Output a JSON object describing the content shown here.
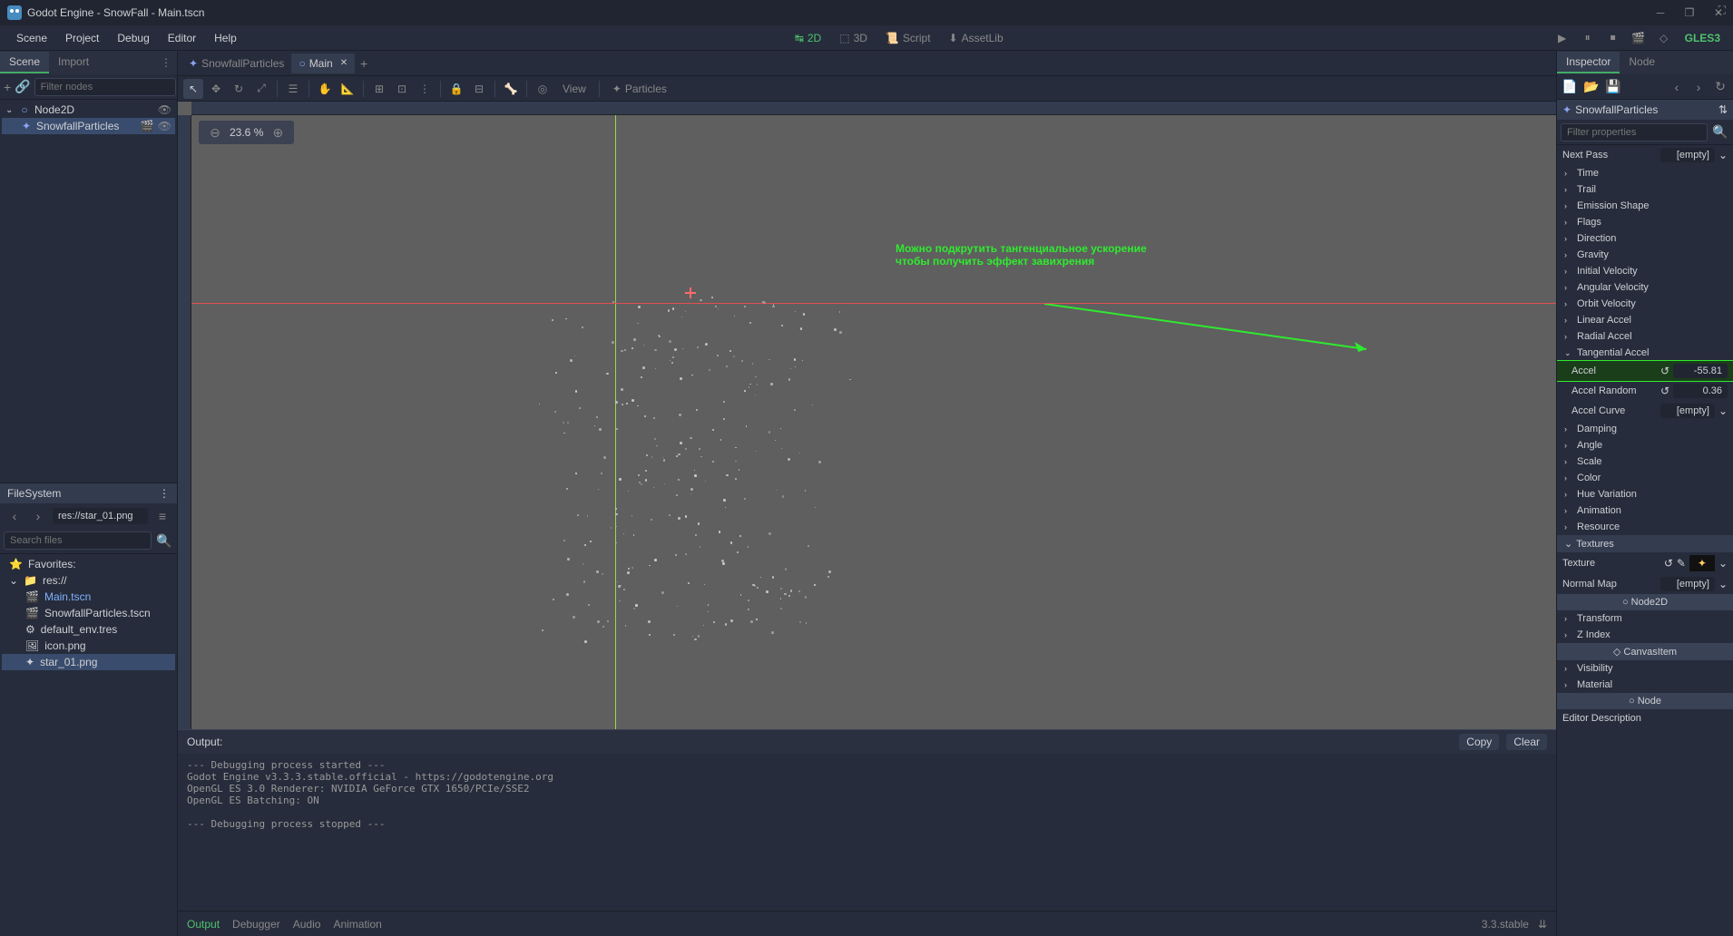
{
  "titlebar": {
    "title": "Godot Engine - SnowFall - Main.tscn"
  },
  "menubar": {
    "items": [
      "Scene",
      "Project",
      "Debug",
      "Editor",
      "Help"
    ]
  },
  "workspaces": {
    "items": [
      "2D",
      "3D",
      "Script",
      "AssetLib"
    ],
    "active": "2D"
  },
  "renderer": "GLES3",
  "scene_panel": {
    "tabs": [
      "Scene",
      "Import"
    ],
    "active_tab": "Scene",
    "filter_placeholder": "Filter nodes",
    "root": "Node2D",
    "child": "SnowfallParticles"
  },
  "scene_tabs": {
    "tabs": [
      {
        "name": "SnowfallParticles",
        "active": false
      },
      {
        "name": "Main",
        "active": true
      }
    ]
  },
  "viewport": {
    "view_label": "View",
    "particles_label": "Particles",
    "zoom": "23.6 %"
  },
  "annotation": {
    "text": "Можно подкрутить тангенциальное ускорение\nчтобы получить эффект завихрения"
  },
  "filesystem": {
    "title": "FileSystem",
    "current_path": "res://star_01.png",
    "search_placeholder": "Search files",
    "favorites_label": "Favorites:",
    "root": "res://",
    "files": [
      {
        "name": "Main.tscn",
        "highlighted": true
      },
      {
        "name": "SnowfallParticles.tscn"
      },
      {
        "name": "default_env.tres"
      },
      {
        "name": "icon.png"
      },
      {
        "name": "star_01.png",
        "selected": true
      }
    ]
  },
  "output": {
    "title": "Output:",
    "copy": "Copy",
    "clear": "Clear",
    "text": "--- Debugging process started ---\nGodot Engine v3.3.3.stable.official - https://godotengine.org\nOpenGL ES 3.0 Renderer: NVIDIA GeForce GTX 1650/PCIe/SSE2\nOpenGL ES Batching: ON\n\n--- Debugging process stopped ---"
  },
  "bottom_panel": {
    "tabs": [
      "Output",
      "Debugger",
      "Audio",
      "Animation"
    ],
    "active": "Output",
    "version": "3.3.stable"
  },
  "inspector": {
    "tabs": [
      "Inspector",
      "Node"
    ],
    "active_tab": "Inspector",
    "node_name": "SnowfallParticles",
    "filter_placeholder": "Filter properties",
    "next_pass_label": "Next Pass",
    "next_pass_value": "[empty]",
    "groups": [
      "Time",
      "Trail",
      "Emission Shape",
      "Flags",
      "Direction",
      "Gravity",
      "Initial Velocity",
      "Angular Velocity",
      "Orbit Velocity",
      "Linear Accel",
      "Radial Accel"
    ],
    "tangential": {
      "label": "Tangential Accel",
      "accel_label": "Accel",
      "accel_value": "-55.81",
      "random_label": "Accel Random",
      "random_value": "0.36",
      "curve_label": "Accel Curve",
      "curve_value": "[empty]"
    },
    "groups2": [
      "Damping",
      "Angle",
      "Scale",
      "Color",
      "Hue Variation",
      "Animation",
      "Resource"
    ],
    "textures_label": "Textures",
    "texture_label": "Texture",
    "normal_map_label": "Normal Map",
    "normal_map_value": "[empty]",
    "node2d_label": "Node2D",
    "groups3": [
      "Transform",
      "Z Index"
    ],
    "canvasitem_label": "CanvasItem",
    "groups4": [
      "Visibility",
      "Material"
    ],
    "node_label": "Node",
    "editor_desc_label": "Editor Description"
  }
}
